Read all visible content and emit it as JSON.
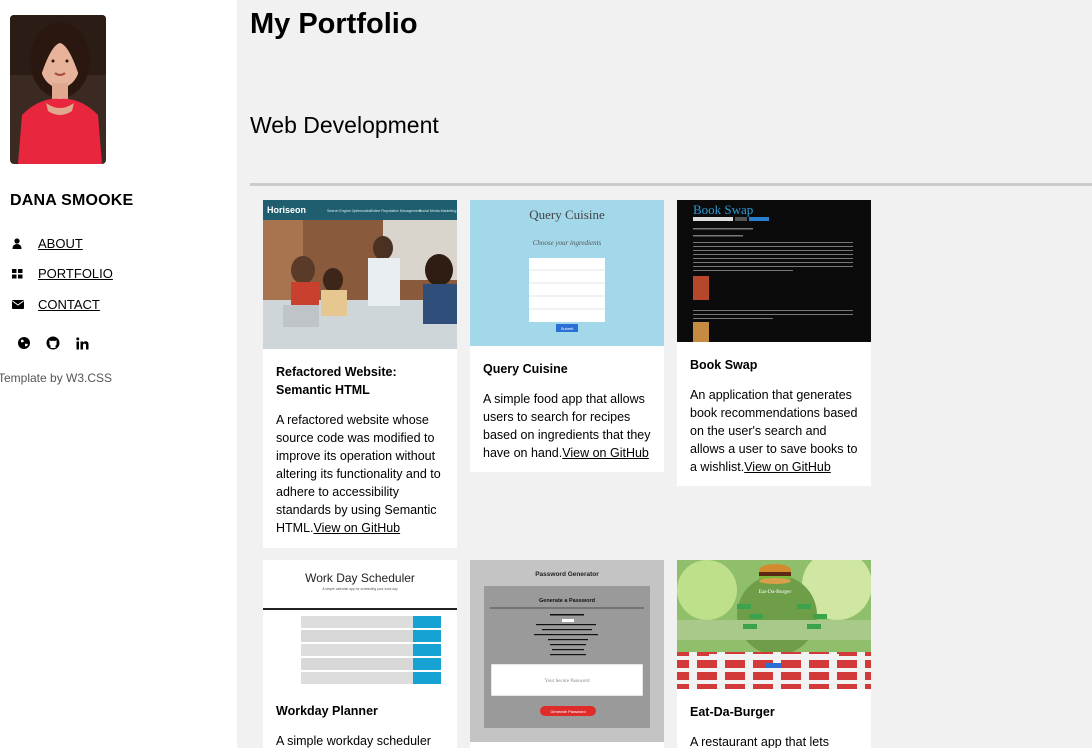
{
  "sidebar": {
    "name": "DANA SMOOKE",
    "nav": [
      {
        "label": "ABOUT",
        "icon": "user-icon"
      },
      {
        "label": "PORTFOLIO",
        "icon": "grid-icon"
      },
      {
        "label": "CONTACT",
        "icon": "envelope-icon"
      }
    ],
    "social": [
      "globe-icon",
      "github-icon",
      "linkedin-icon"
    ],
    "credit": "Template by W3.CSS"
  },
  "main": {
    "title": "My Portfolio",
    "section_title": "Web Development",
    "projects": [
      {
        "title": "Refactored Website: Semantic HTML",
        "description": "A refactored website whose source code was modified to improve its operation without altering its functionality and to adhere to accessibility standards by using Semantic HTML.",
        "link": "View on GitHub",
        "thumb": {
          "brand": "Horiseon",
          "nav": [
            "Search Engine Optimization",
            "Online Reputation Management",
            "Social Media Marketing"
          ]
        }
      },
      {
        "title": "Query Cuisine",
        "description": "A simple food app that allows users to search for recipes based on ingredients that they have on hand.",
        "link": "View on GitHub",
        "thumb": {
          "heading": "Query Cuisine",
          "subheading": "Choose your ingredients",
          "button": "Submit"
        }
      },
      {
        "title": "Book Swap",
        "description": "An application that generates book recommendations based on the user's search and allows a user to save books to a wishlist.",
        "link": "View on GitHub",
        "thumb": {
          "heading": "Book Swap"
        }
      },
      {
        "title": "Workday Planner",
        "description": "A simple workday scheduler",
        "link": "",
        "thumb": {
          "heading": "Work Day Scheduler",
          "subheading": "A simple calendar app for scheduling your work day"
        }
      },
      {
        "title": "",
        "description": "",
        "link": "",
        "thumb": {
          "heading": "Password Generator",
          "panel_heading": "Generate a Password",
          "placeholder": "Your Secure Password",
          "button": "Generate Password"
        }
      },
      {
        "title": "Eat-Da-Burger",
        "description": "A restaurant app that lets users",
        "link": "",
        "thumb": {
          "heading": "Eat-Da-Burger"
        }
      }
    ]
  },
  "colors": {
    "sidebar_bg": "#ffffff",
    "main_bg": "#f1f1f1",
    "rule": "#cccccc"
  }
}
